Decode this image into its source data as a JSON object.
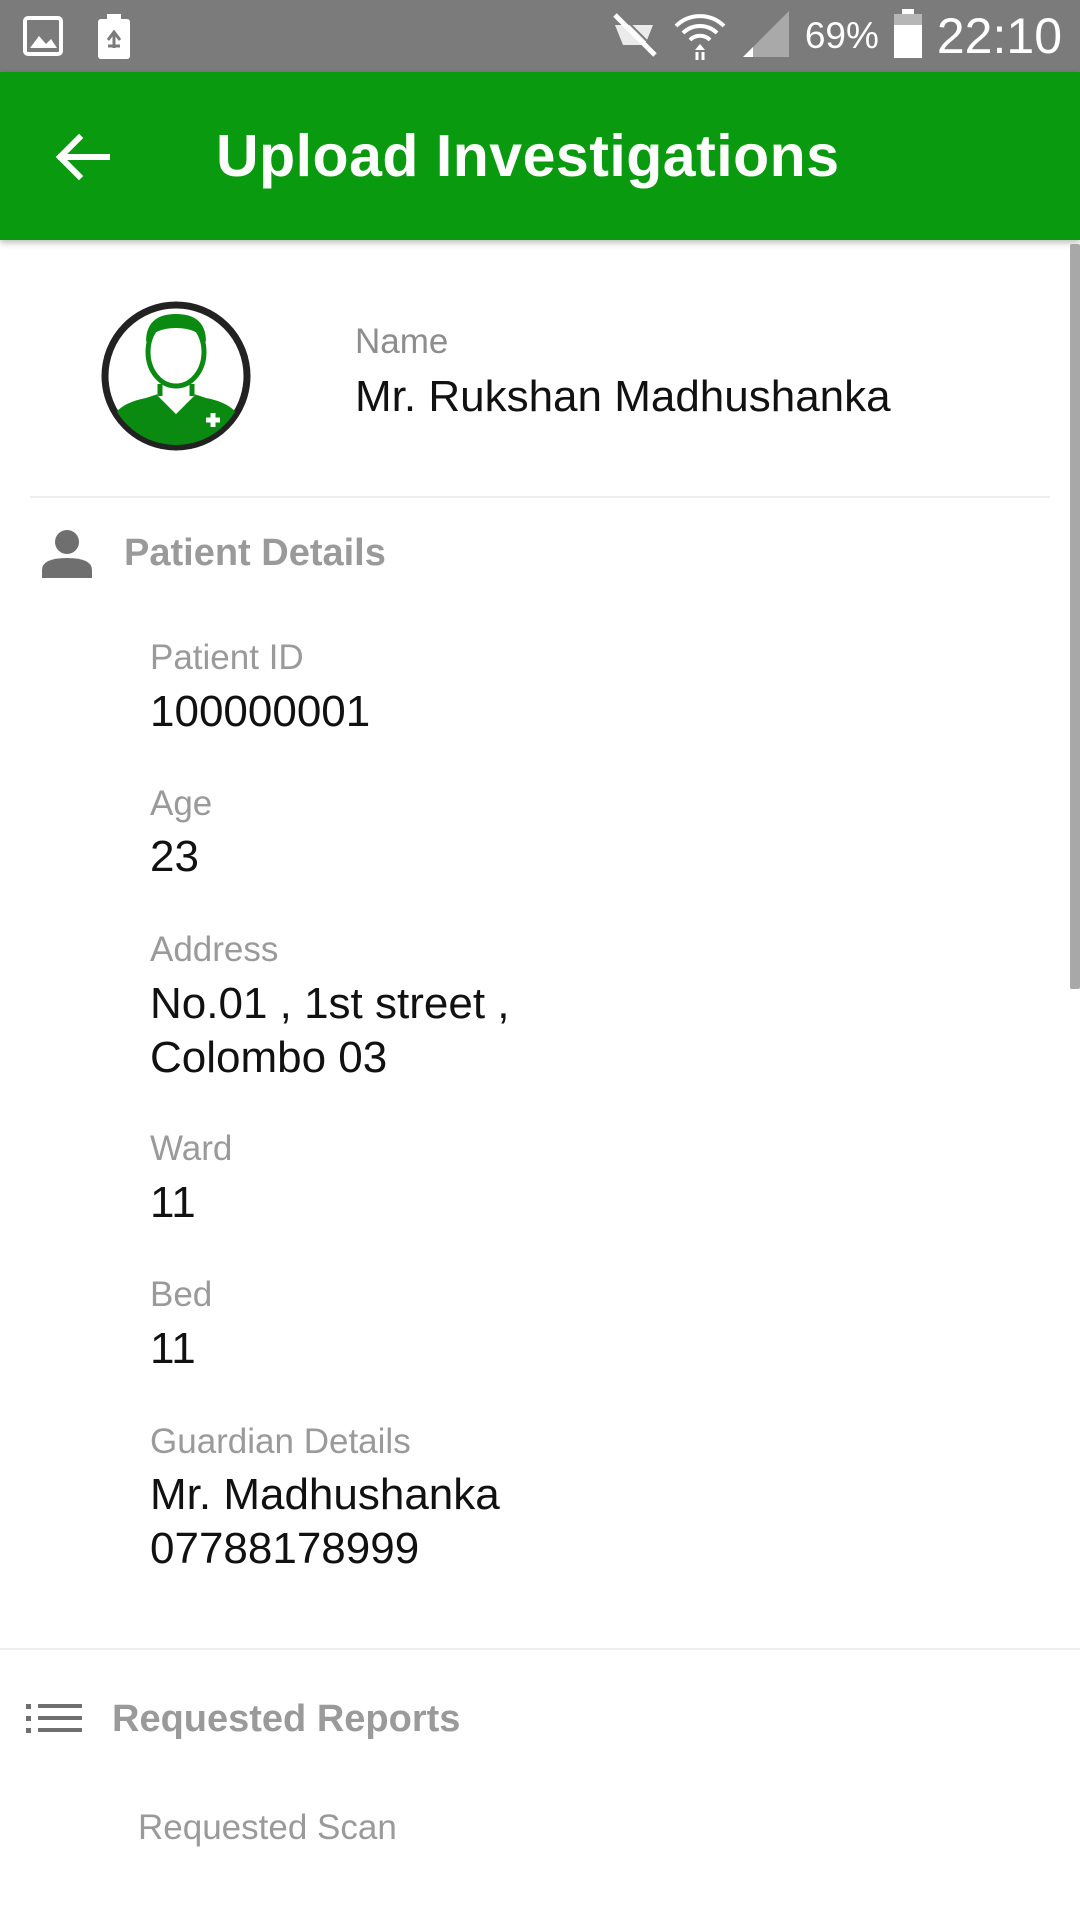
{
  "status_bar": {
    "battery_percent": "69%",
    "time": "22:10"
  },
  "app_bar": {
    "title": "Upload Investigations"
  },
  "profile": {
    "name_label": "Name",
    "name_value": "Mr. Rukshan Madhushanka"
  },
  "patient_details": {
    "title": "Patient Details",
    "fields": [
      {
        "label": "Patient ID",
        "value": "100000001"
      },
      {
        "label": "Age",
        "value": "23"
      },
      {
        "label": "Address",
        "value_line1": "No.01 , 1st street ,",
        "value_line2": "Colombo 03"
      },
      {
        "label": "Ward",
        "value": "11"
      },
      {
        "label": "Bed",
        "value": "11"
      },
      {
        "label": "Guardian Details",
        "value_line1": "Mr. Madhushanka",
        "value_line2": "07788178999"
      }
    ]
  },
  "requested_reports": {
    "title": "Requested Reports",
    "first_item": "Requested Scan"
  },
  "colors": {
    "app_bar": "#0a9a10",
    "status_bar": "#7b7b7b",
    "avatar_green": "#0a8a10"
  },
  "icons": [
    "gallery-icon",
    "recycle-icon",
    "mute-icon",
    "wifi-icon",
    "signal-icon",
    "battery-icon",
    "back-arrow-icon",
    "doctor-avatar-icon",
    "person-icon",
    "list-icon"
  ]
}
